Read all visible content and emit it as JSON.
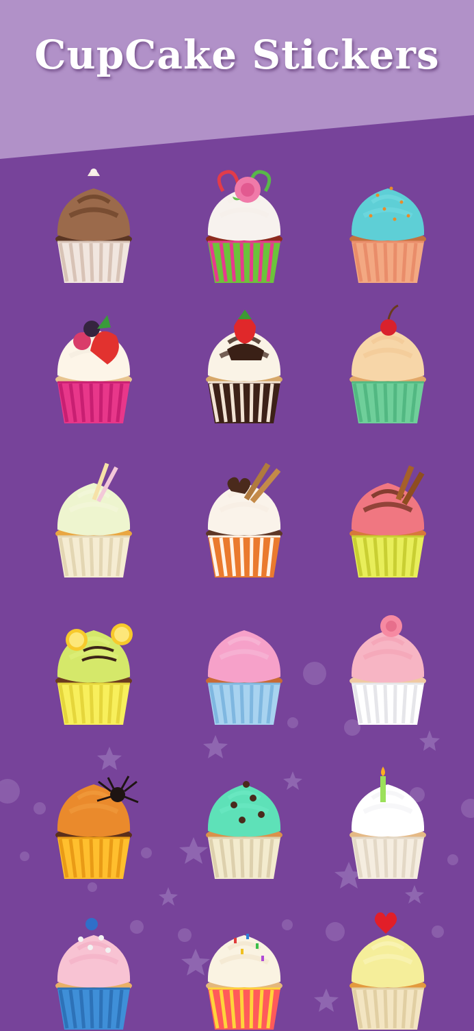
{
  "header": {
    "title": "CupCake Stickers"
  },
  "colors": {
    "background": "#77439a",
    "header_band": "#b191c8",
    "title": "#ffffff"
  },
  "stickers": [
    {
      "name": "chocolate-star-wrapper-cupcake",
      "frosting": "#9b6a4b",
      "top": "#6b4228",
      "wrapper": "#f1e6df",
      "wrapper_stripe": "#d8c3b6",
      "cake": "#5a3523",
      "topper": "chocolate-tip"
    },
    {
      "name": "rose-candy-cane-heart-cupcake",
      "frosting": "#f7f2ee",
      "top": "#f5f0ea",
      "wrapper": "#6cc33b",
      "wrapper_stripe": "#e73a8e",
      "cake": "#8d2b1f",
      "topper": "rose"
    },
    {
      "name": "teal-sprinkle-cupcake",
      "frosting": "#5ecfd6",
      "top": "#6fd8df",
      "wrapper": "#f3a882",
      "wrapper_stripe": "#e98d6a",
      "cake": "#c2723f",
      "topper": "sprinkles"
    },
    {
      "name": "berry-strawberry-cupcake",
      "frosting": "#fdf5e8",
      "top": "#f3ede0",
      "wrapper": "#e8378a",
      "wrapper_stripe": "#c81f72",
      "cake": "#e8c48f",
      "topper": "berries"
    },
    {
      "name": "chocolate-drizzle-strawberry-cupcake",
      "frosting": "#faf3e6",
      "top": "#3a2016",
      "wrapper": "#3d2118",
      "wrapper_stripe": "#f2e3d4",
      "cake": "#d7a86a",
      "topper": "strawberry"
    },
    {
      "name": "cherry-sprinkle-cupcake",
      "frosting": "#f7d6a8",
      "top": "#f2c996",
      "wrapper": "#6fcf9a",
      "wrapper_stripe": "#52b882",
      "cake": "#e2a869",
      "topper": "cherry"
    },
    {
      "name": "straw-chip-vanilla-cupcake",
      "frosting": "#eef5cf",
      "top": "#f3f7da",
      "wrapper": "#f5ecd2",
      "wrapper_stripe": "#e3d6b3",
      "cake": "#e9a640",
      "topper": "straws"
    },
    {
      "name": "wafer-heart-chocolate-cupcake",
      "frosting": "#faf3ea",
      "top": "#f7ede2",
      "wrapper": "#ea7a2e",
      "wrapper_stripe": "#fff3e6",
      "cake": "#5d3626",
      "topper": "wafer-heart"
    },
    {
      "name": "chocolate-wafer-pink-cupcake",
      "frosting": "#f07781",
      "top": "#6a2e1b",
      "wrapper": "#e8ee5a",
      "wrapper_stripe": "#c9cf33",
      "cake": "#d7783b",
      "topper": "wafer"
    },
    {
      "name": "lemon-swirl-cupcake",
      "frosting": "#d5e86a",
      "top": "#ddf07a",
      "wrapper": "#f8ef5c",
      "wrapper_stripe": "#e5d63c",
      "cake": "#6b3a1f",
      "topper": "lemon"
    },
    {
      "name": "pink-swirl-blue-cupcake",
      "frosting": "#f6a1c9",
      "top": "#f7b6d6",
      "wrapper": "#a8d3f0",
      "wrapper_stripe": "#7fb7e0",
      "cake": "#c96a34",
      "topper": "none"
    },
    {
      "name": "pink-rose-white-cupcake",
      "frosting": "#f7b5c4",
      "top": "#f4a4b6",
      "wrapper": "#ffffff",
      "wrapper_stripe": "#e6e6ea",
      "cake": "#f0c9a2",
      "topper": "rose-pink"
    },
    {
      "name": "spider-brain-cupcake",
      "frosting": "#ea8a2c",
      "top": "#f09a3c",
      "wrapper": "#ffbf2e",
      "wrapper_stripe": "#e99b16",
      "cake": "#5b2f1b",
      "topper": "spider"
    },
    {
      "name": "mint-chocolate-heart-cupcake",
      "frosting": "#5ee1b8",
      "top": "#6ae8c2",
      "wrapper": "#f3ebce",
      "wrapper_stripe": "#ddd0ad",
      "cake": "#d9914b",
      "topper": "hearts"
    },
    {
      "name": "birthday-candle-cupcake",
      "frosting": "#ffffff",
      "top": "#f4f4f6",
      "wrapper": "#f5ede0",
      "wrapper_stripe": "#e3d8c6",
      "cake": "#e5b985",
      "topper": "candle"
    },
    {
      "name": "pink-blue-ball-cupcake",
      "frosting": "#f8c3d3",
      "top": "#f3b0c6",
      "wrapper": "#3f8fd8",
      "wrapper_stripe": "#2d72b8",
      "cake": "#e9b067",
      "topper": "ball"
    },
    {
      "name": "rainbow-sprinkle-cupcake",
      "frosting": "#faf3e2",
      "top": "#f2e6cf",
      "wrapper": "#ff5a5a",
      "wrapper_stripe": "#ffd43b",
      "cake": "#e3b77c",
      "topper": "rainbow"
    },
    {
      "name": "heart-vanilla-cupcake",
      "frosting": "#f5ee9a",
      "top": "#faf4b6",
      "wrapper": "#f3e5c2",
      "wrapper_stripe": "#e1cfa3",
      "cake": "#e39a3e",
      "topper": "red-heart"
    }
  ]
}
